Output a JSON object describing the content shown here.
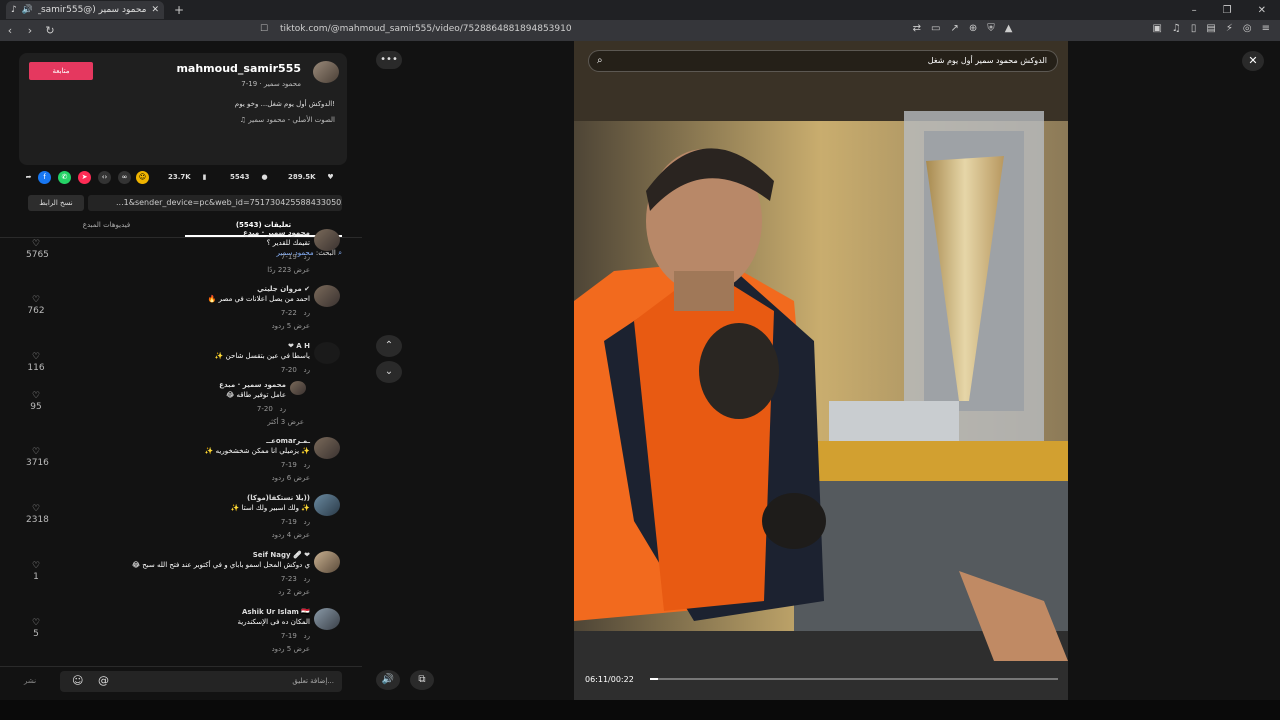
{
  "browser": {
    "tab_title": "محمود سمير (@mahmoud_samir555",
    "url": "tiktok.com/@mahmoud_samir555/video/7528864881894853910",
    "window_buttons": [
      "–",
      "❐",
      "✕"
    ]
  },
  "author": {
    "username": "mahmoud_samir555",
    "subtitle": "محمود سمير · 19-7",
    "follow_label": "متابعة",
    "description": "الدوكش أول يوم شغل... وخو يوم!",
    "sound": "♫ الصوت الأصلي - محمود سمير"
  },
  "stats": {
    "likes": "289.5K",
    "comments": "5543",
    "saves": "23.7K"
  },
  "share": {
    "copy_label": "نسخ الرابط",
    "link_text": "...1&sender_device=pc&web_id=7517304255884330502"
  },
  "tabs": {
    "comments_label": "تعليقات (5543)",
    "creator_videos_label": "فيديوهات المبدع"
  },
  "search": {
    "prefix": "البحث:",
    "keyword": "محمود سمير"
  },
  "comments": [
    {
      "name": "محمود سمير · مبدع",
      "text": "تقيمك للقدير ؟",
      "date": "7-19",
      "reply": "رد",
      "view": "عرض 223 ردًا",
      "likes": "5765"
    },
    {
      "name": "مروان جليتي ✔",
      "text": "🔥 احمد من يصل اعلانات في مصر",
      "date": "7-22",
      "reply": "رد",
      "view": "عرض 5 ردود",
      "likes": "762"
    },
    {
      "name": "❤ A H",
      "text": "✨ ياسطا في عين بتقسل شاحن",
      "date": "7-20",
      "reply": "رد",
      "view": "",
      "likes": "116"
    },
    {
      "name": "محمود سمير · مبدع",
      "text": "😂 عامل توفير طاقه",
      "date": "7-20",
      "reply": "رد",
      "view": "عرض 3 أكثر",
      "likes": "95"
    },
    {
      "name": "عــomarـمـر",
      "text": "✨ يزميلي انا ممكن شخشخوريه ✨",
      "date": "7-19",
      "reply": "رد",
      "view": "عرض 6 ردود",
      "likes": "3716"
    },
    {
      "name": "(موكا)يلا نستكفا))",
      "text": "✨ ولك اسبير ولك استا ✨",
      "date": "7-19",
      "reply": "رد",
      "view": "عرض 4 ردود",
      "likes": "2318"
    },
    {
      "name": "Seif Nagy 🩹 ❤",
      "text": "😂 ي دوكش المحل اسمو باباي و في أكتوبر عند فتح الله سبح",
      "date": "7-23",
      "reply": "رد",
      "view": "عرض 2 رد",
      "likes": "1"
    },
    {
      "name": "Ashik Ur Islam 🇪🇬",
      "text": "المكان ده فى الإسكندرية",
      "date": "7-19",
      "reply": "رد",
      "view": "عرض 5 ردود",
      "likes": "5"
    }
  ],
  "composer": {
    "placeholder": "إضافة تعليق...",
    "post_label": "نشر"
  },
  "video": {
    "caption": "الدوكش محمود سمير أول يوم شغل",
    "time": "06:11/00:22",
    "progress": 0.02
  },
  "colors": {
    "accent": "#e5385f",
    "keyword": "#8ab4ff"
  }
}
